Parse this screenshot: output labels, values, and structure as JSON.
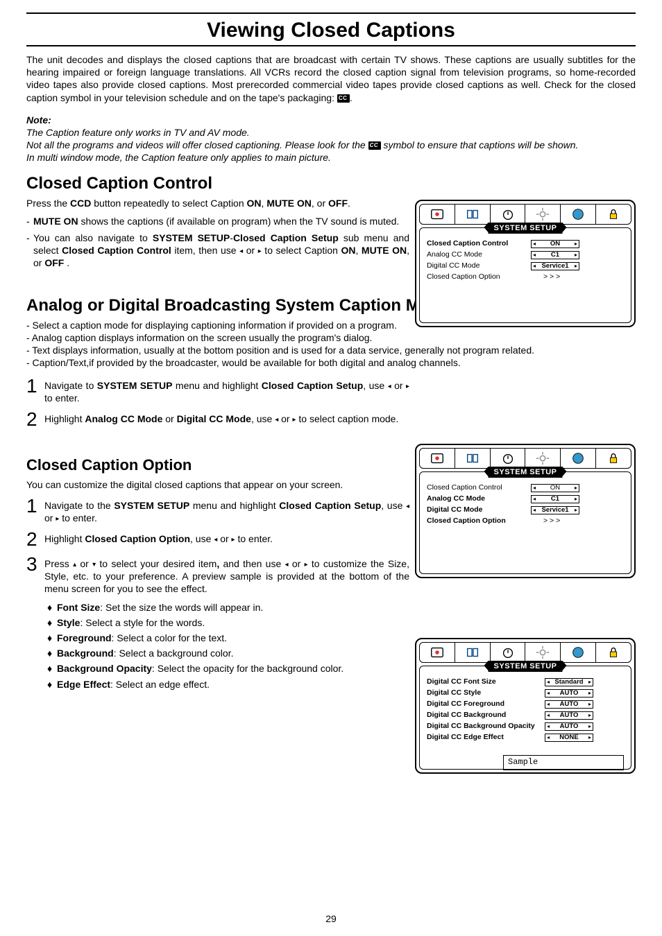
{
  "page_title": "Viewing Closed Captions",
  "intro": "The unit decodes and displays the closed captions that are broadcast with certain TV shows. These captions are usually subtitles for the hearing impaired or foreign language translations. All VCRs record the closed caption signal from television programs, so home-recorded video tapes also provide closed captions. Most prerecorded commercial video tapes provide closed captions as well. Check for the closed caption symbol in your television schedule and on the tape's packaging: ",
  "note_label": "Note:",
  "note_line1": "The Caption feature only works in TV and AV mode.",
  "note_line2a": "Not all the programs and videos will offer closed captioning. Please look for the ",
  "note_line2b": " symbol to ensure that captions will be shown.",
  "note_line3": "In multi window mode, the Caption feature only applies to main picture.",
  "sec1_title": "Closed Caption Control",
  "sec1_p1a": "Press the ",
  "sec1_p1_ccd": "CCD",
  "sec1_p1b": " button repeatedly to select Caption ",
  "sec1_on": "ON",
  "sec1_muteon": "MUTE ON",
  "sec1_or": ", or ",
  "sec1_off": "OFF",
  "sec1_dot": ".",
  "sec1_d1a": "MUTE ON",
  "sec1_d1b": " shows the captions (if available on program) when the TV sound is muted.",
  "sec1_d2a": "You can also navigate to ",
  "sec1_d2_sys": "SYSTEM SETUP",
  "sec1_d2_dash": "-",
  "sec1_d2_ccs": "Closed Caption Setup",
  "sec1_d2b": " sub menu and select ",
  "sec1_d2_ccc": "Closed Caption Control",
  "sec1_d2c": " item, then use ",
  "sec1_d2d": " to select Caption ",
  "sec1_d2_or2": ", or ",
  "sec1_d2_sp": " .",
  "sec2_title": "Analog or Digital Broadcasting System Caption Mode",
  "sec2_l1": "- Select a caption mode for displaying captioning information if provided on a program.",
  "sec2_l2": "- Analog caption displays information on the screen usually the program's dialog.",
  "sec2_l3": "- Text displays information, usually at the bottom position and is used for a data service, generally not program related.",
  "sec2_l4": "- Caption/Text,if provided by the broadcaster, would be available for both digital and analog channels.",
  "sec2_s1a": "Navigate to ",
  "sec2_s1_sys": "SYSTEM SETUP",
  "sec2_s1b": " menu and highlight ",
  "sec2_s1_cc": "Closed Caption Setup",
  "sec2_s1c": ", use ",
  "sec2_s1d": " to enter.",
  "sec2_s2a": "Highlight ",
  "sec2_s2_an": "Analog CC Mode",
  "sec2_s2_or": " or ",
  "sec2_s2_dg": "Digital CC Mode",
  "sec2_s2b": ", use ",
  "sec2_s2c": " to select caption mode.",
  "sec3_title": "Closed Caption Option",
  "sec3_p": "You can customize the digital closed captions that appear on your screen.",
  "sec3_s1a": "Navigate to the ",
  "sec3_s1_sys": "SYSTEM SETUP",
  "sec3_s1b": " menu and highlight ",
  "sec3_s1_cc": "Closed Caption Setup",
  "sec3_s1c": ", use ",
  "sec3_s1d": " to enter.",
  "sec3_s2a": "Highlight ",
  "sec3_s2_cco": "Closed Caption Option",
  "sec3_s2b": ", use ",
  "sec3_s2c": " to enter.",
  "sec3_s3a": "Press ",
  "sec3_s3b": " to select your desired item",
  "sec3_s3comma": ",",
  "sec3_s3c": " and then use ",
  "sec3_s3d": " to customize the Size, Style, etc. to your preference. A preview sample is provided at the bottom of the menu screen for you to see the effect.",
  "bul1a": "Font Size",
  "bul1b": ": Set the size the words will appear in.",
  "bul2a": "Style",
  "bul2b": ": Select a style for the words.",
  "bul3a": "Foreground",
  "bul3b": ": Select a color for the text.",
  "bul4a": "Background",
  "bul4b": ": Select a background color.",
  "bul5a": "Background Opacity",
  "bul5b": ": Select the opacity for the background color.",
  "bul6a": "Edge Effect",
  "bul6b": ": Select an edge effect.",
  "osd_header": "SYSTEM SETUP",
  "osd1": {
    "r1": {
      "label": "Closed Caption Control",
      "val": "ON"
    },
    "r2": {
      "label": "Analog CC Mode",
      "val": "C1"
    },
    "r3": {
      "label": "Digital CC Mode",
      "val": "Service1"
    },
    "r4": {
      "label": "Closed Caption Option",
      "val": "> > >"
    }
  },
  "osd2": {
    "r1": {
      "label": "Closed Caption Control",
      "val": "ON"
    },
    "r2": {
      "label": "Analog CC Mode",
      "val": "C1"
    },
    "r3": {
      "label": "Digital CC Mode",
      "val": "Service1"
    },
    "r4": {
      "label": "Closed Caption Option",
      "val": "> > >"
    }
  },
  "osd3": {
    "r1": {
      "label": "Digital CC Font Size",
      "val": "Standard"
    },
    "r2": {
      "label": "Digital CC Style",
      "val": "AUTO"
    },
    "r3": {
      "label": "Digital CC Foreground",
      "val": "AUTO"
    },
    "r4": {
      "label": "Digital CC Background",
      "val": "AUTO"
    },
    "r5": {
      "label": "Digital CC Background Opacity",
      "val": "AUTO"
    },
    "r6": {
      "label": "Digital CC Edge Effect",
      "val": "NONE"
    },
    "sample": "Sample"
  },
  "page_number": "29",
  "arrows": {
    "left": "◂",
    "right": "▸",
    "up": "▴",
    "down": "▾",
    "or": " or "
  }
}
